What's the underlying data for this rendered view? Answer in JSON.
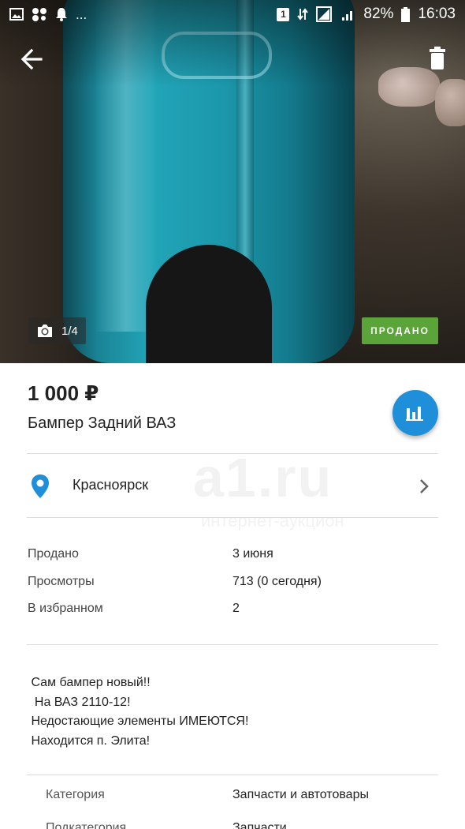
{
  "status_bar": {
    "left_icons": [
      "image-icon",
      "dots-icon",
      "bell-icon",
      "more-dots"
    ],
    "more_text": "...",
    "sim_label": "1",
    "battery_percent": "82%",
    "time": "16:03"
  },
  "hero": {
    "photo_counter": "1/4",
    "sold_badge": "ПРОДАНО",
    "accent_color": "#22a5b8"
  },
  "listing": {
    "price": "1 000 ₽",
    "title": "Бампер Задний ВАЗ",
    "location": "Красноярск"
  },
  "watermark": {
    "brand": "a1.ru",
    "subtitle": "интернет-аукцион"
  },
  "stats": [
    {
      "label": "Продано",
      "value": "3 июня"
    },
    {
      "label": "Просмотры",
      "value": "713 (0 сегодня)"
    },
    {
      "label": "В избранном",
      "value": "2"
    }
  ],
  "description": " Сам бампер новый!!\n  На ВАЗ 2110-12!\n Недостающие элементы ИМЕЮТСЯ!\n Находится п. Элита!",
  "details": [
    {
      "label": "Категория",
      "value": "Запчасти и автотовары"
    },
    {
      "label": "Подкатегория",
      "value": "Запчасти"
    }
  ],
  "colors": {
    "fab": "#1e8fd8",
    "sold": "#5aa43a",
    "pin": "#1e8fd8"
  }
}
